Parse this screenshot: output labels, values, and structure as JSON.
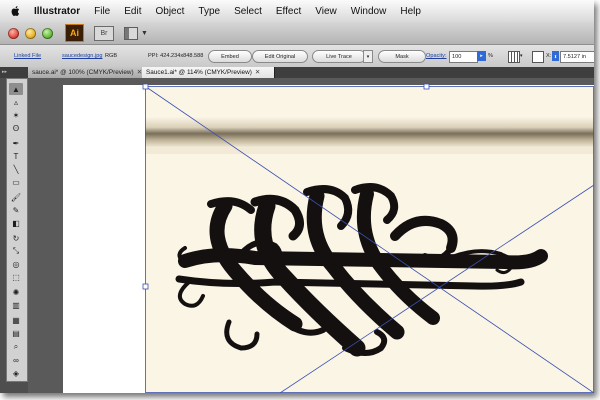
{
  "menu_bar": {
    "items": [
      "Illustrator",
      "File",
      "Edit",
      "Object",
      "Type",
      "Select",
      "Effect",
      "View",
      "Window",
      "Help"
    ]
  },
  "app_bar": {
    "app_icon_label": "Ai",
    "bridge_label": "Br"
  },
  "control_bar": {
    "linked_file": "Linked File",
    "file_name": "saucedesign.jpg",
    "color_mode": "RGB",
    "ppi": "PPI: 424.234x848.588",
    "embed": "Embed",
    "edit_original": "Edit Original",
    "live_trace": "Live Trace",
    "mask": "Mask",
    "opacity_label": "Opacity:",
    "opacity_value": "100",
    "opacity_unit": "%",
    "x_label": "X:",
    "x_value": "7.5127 in"
  },
  "tabs": [
    {
      "label": "sauce.ai* @ 100% (CMYK/Preview)",
      "active": false
    },
    {
      "label": "Sauce1.ai* @ 114% (CMYK/Preview)",
      "active": true
    }
  ],
  "tools": [
    {
      "name": "selection-tool-icon",
      "glyph": "▲"
    },
    {
      "name": "direct-selection-tool-icon",
      "glyph": "▵"
    },
    {
      "name": "magic-wand-tool-icon",
      "glyph": "✶"
    },
    {
      "name": "lasso-tool-icon",
      "glyph": "ʘ"
    },
    {
      "name": "pen-tool-icon",
      "glyph": "✒"
    },
    {
      "name": "type-tool-icon",
      "glyph": "T"
    },
    {
      "name": "line-tool-icon",
      "glyph": "╲"
    },
    {
      "name": "rectangle-tool-icon",
      "glyph": "▭"
    },
    {
      "name": "paintbrush-tool-icon",
      "glyph": "🖌"
    },
    {
      "name": "pencil-tool-icon",
      "glyph": "✎"
    },
    {
      "name": "eraser-tool-icon",
      "glyph": "◧"
    },
    {
      "name": "rotate-tool-icon",
      "glyph": "↻"
    },
    {
      "name": "scale-tool-icon",
      "glyph": "⤡"
    },
    {
      "name": "warp-tool-icon",
      "glyph": "◎"
    },
    {
      "name": "free-transform-tool-icon",
      "glyph": "⬚"
    },
    {
      "name": "symbol-sprayer-tool-icon",
      "glyph": "✺"
    },
    {
      "name": "column-graph-tool-icon",
      "glyph": "▥"
    },
    {
      "name": "mesh-tool-icon",
      "glyph": "▦"
    },
    {
      "name": "gradient-tool-icon",
      "glyph": "▤"
    },
    {
      "name": "eyedropper-tool-icon",
      "glyph": "⌕"
    },
    {
      "name": "blend-tool-icon",
      "glyph": "∞"
    },
    {
      "name": "live-paint-tool-icon",
      "glyph": "◈"
    }
  ],
  "colors": {
    "accent_blue": "#2f6bd6",
    "link_blue": "#1d3fa0",
    "canvas_grey": "#5a5a5a",
    "paper": "#fbf5e6",
    "ink": "#141010",
    "bounding_box": "#3a4fb0"
  }
}
